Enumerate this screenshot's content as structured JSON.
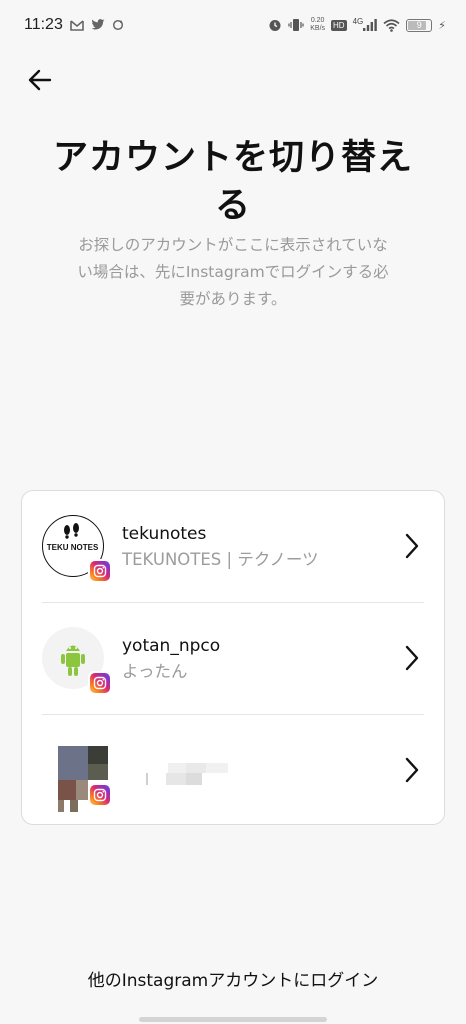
{
  "status_bar": {
    "time": "11:23",
    "net_speed_value": "0.20",
    "net_speed_unit": "KB/s",
    "hd_label": "HD",
    "network_label": "4G",
    "battery_level": "9"
  },
  "header": {
    "title_line1": "アカウントを切り替え",
    "title_line2": "る",
    "subtitle_line1": "お探しのアカウントがここに表示されていな",
    "subtitle_line2": "い場合は、先にInstagramでログインする必",
    "subtitle_line3": "要があります。"
  },
  "accounts": [
    {
      "username": "tekunotes",
      "display_name": "TEKUNOTES | テクノーツ",
      "avatar_text": "TEKU NOTES"
    },
    {
      "username": "yotan_npco",
      "display_name": "よったん"
    },
    {
      "username": "",
      "display_name": ""
    }
  ],
  "footer": {
    "login_other_label": "他のInstagramアカウントにログイン"
  },
  "colors": {
    "background": "#f7f7f7",
    "secondary_text": "#9a9a9a",
    "instagram_gradient": [
      "#fdcb52",
      "#fa7e1e",
      "#d62976",
      "#962fbf",
      "#4f5bd5"
    ]
  }
}
